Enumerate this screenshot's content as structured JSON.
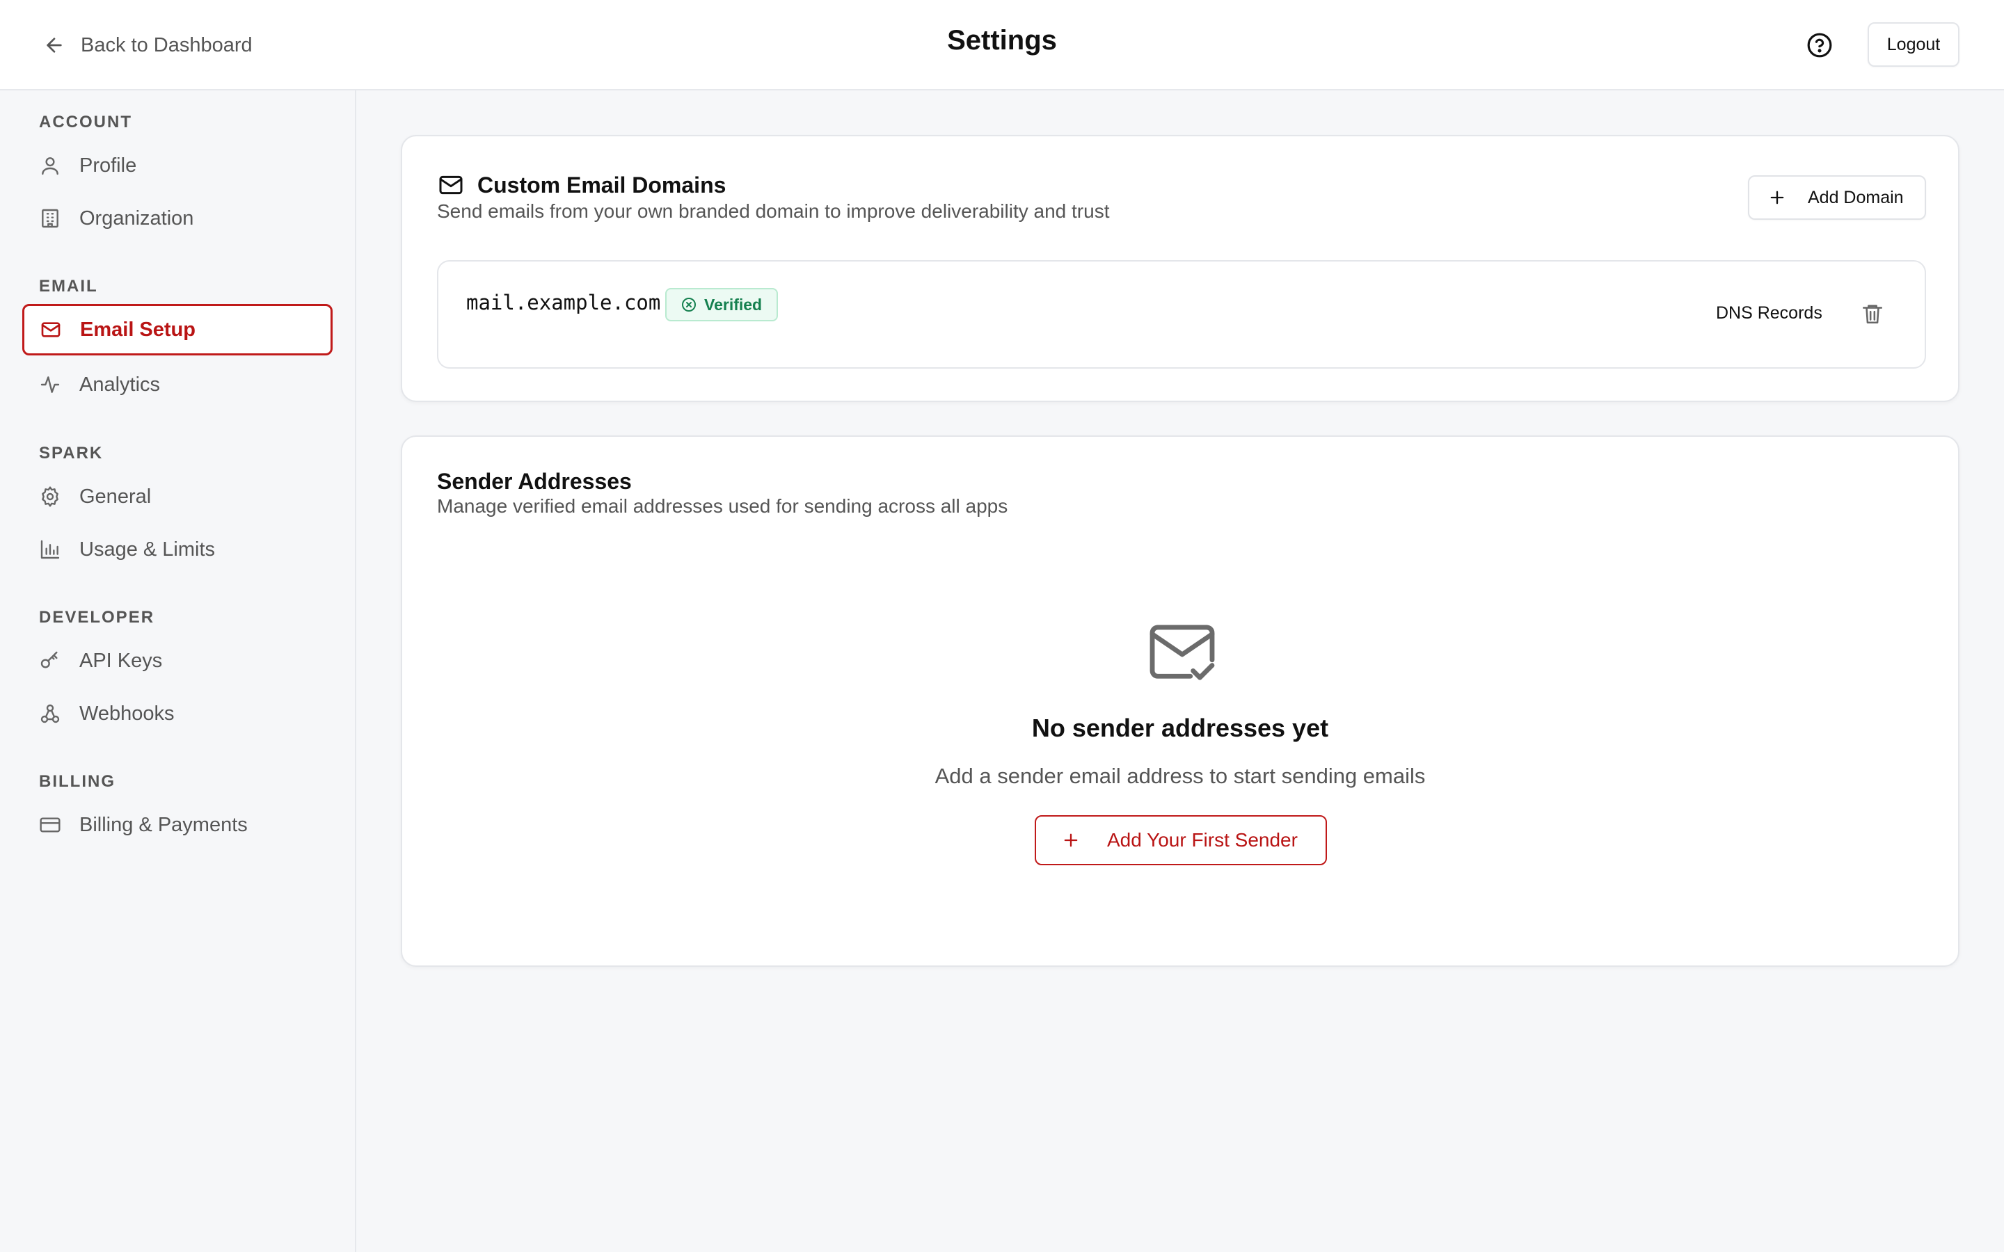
{
  "header": {
    "back_label": "Back to Dashboard",
    "title": "Settings",
    "help_icon": "help-circle-icon",
    "logout_label": "Logout"
  },
  "sidebar": {
    "sections": [
      {
        "title": "ACCOUNT",
        "items": [
          {
            "label": "Profile",
            "icon": "user-icon"
          },
          {
            "label": "Organization",
            "icon": "building-icon"
          }
        ]
      },
      {
        "title": "EMAIL",
        "items": [
          {
            "label": "Email Setup",
            "icon": "mail-icon",
            "active": true
          },
          {
            "label": "Analytics",
            "icon": "activity-icon"
          }
        ]
      },
      {
        "title": "SPARK",
        "items": [
          {
            "label": "General",
            "icon": "gear-icon"
          },
          {
            "label": "Usage & Limits",
            "icon": "bar-chart-icon"
          }
        ]
      },
      {
        "title": "DEVELOPER",
        "items": [
          {
            "label": "API Keys",
            "icon": "key-icon"
          },
          {
            "label": "Webhooks",
            "icon": "webhook-icon"
          }
        ]
      },
      {
        "title": "BILLING",
        "items": [
          {
            "label": "Billing & Payments",
            "icon": "credit-card-icon"
          }
        ]
      }
    ]
  },
  "domains_card": {
    "title": "Custom Email Domains",
    "subtitle": "Send emails from your own branded domain to improve deliverability and trust",
    "add_button_label": "Add Domain",
    "domains": [
      {
        "name": "mail.example.com",
        "status": "Verified",
        "dns_label": "DNS Records"
      }
    ]
  },
  "senders_card": {
    "title": "Sender Addresses",
    "subtitle": "Manage verified email addresses used for sending across all apps",
    "empty_title": "No sender addresses yet",
    "empty_description": "Add a sender email address to start sending emails",
    "add_first_label": "Add Your First Sender"
  },
  "colors": {
    "accent": "#c01a1a",
    "verified_text": "#15804f",
    "verified_bg": "#ecfaf3",
    "page_bg": "#f6f7f9"
  }
}
